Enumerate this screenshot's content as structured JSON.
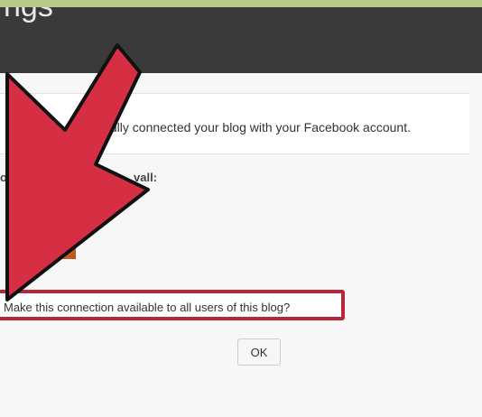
{
  "window": {
    "title_fragment": "ngs"
  },
  "notice": {
    "message": "fully connected your blog with your Facebook account."
  },
  "prompt": {
    "left_fragment": "olic",
    "right_fragment": "vall:"
  },
  "share": {
    "label": "Make this connection available to all users of this blog?"
  },
  "buttons": {
    "ok_label": "OK"
  },
  "colors": {
    "titlebar": "#3a3a3a",
    "highlight_border": "#b5283a",
    "arrow_fill": "#d62f44"
  }
}
